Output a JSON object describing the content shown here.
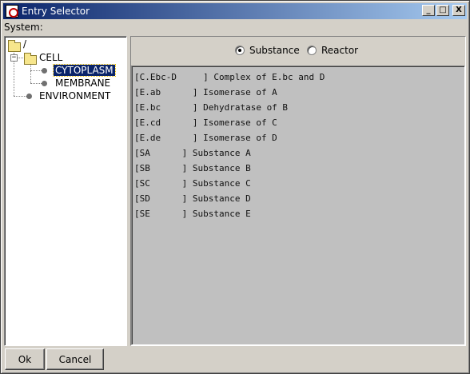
{
  "window": {
    "title": "Entry Selector",
    "controls": {
      "minimize": "_",
      "maximize": "□",
      "close": "X"
    }
  },
  "system_label": "System:",
  "tree": {
    "root": "/",
    "cell": "CELL",
    "cytoplasm": "CYTOPLASM",
    "membrane": "MEMBRANE",
    "environment": "ENVIRONMENT",
    "cell_expander": "−",
    "selected": "CYTOPLASM"
  },
  "radio": {
    "substance": {
      "label": "Substance",
      "checked": true
    },
    "reactor": {
      "label": "Reactor",
      "checked": false
    }
  },
  "entries": [
    "[C.Ebc-D     ] Complex of E.bc and D",
    "[E.ab      ] Isomerase of A",
    "[E.bc      ] Dehydratase of B",
    "[E.cd      ] Isomerase of C",
    "[E.de      ] Isomerase of D",
    "[SA      ] Substance A",
    "[SB      ] Substance B",
    "[SC      ] Substance C",
    "[SD      ] Substance D",
    "[SE      ] Substance E"
  ],
  "buttons": {
    "ok": "Ok",
    "cancel": "Cancel"
  }
}
